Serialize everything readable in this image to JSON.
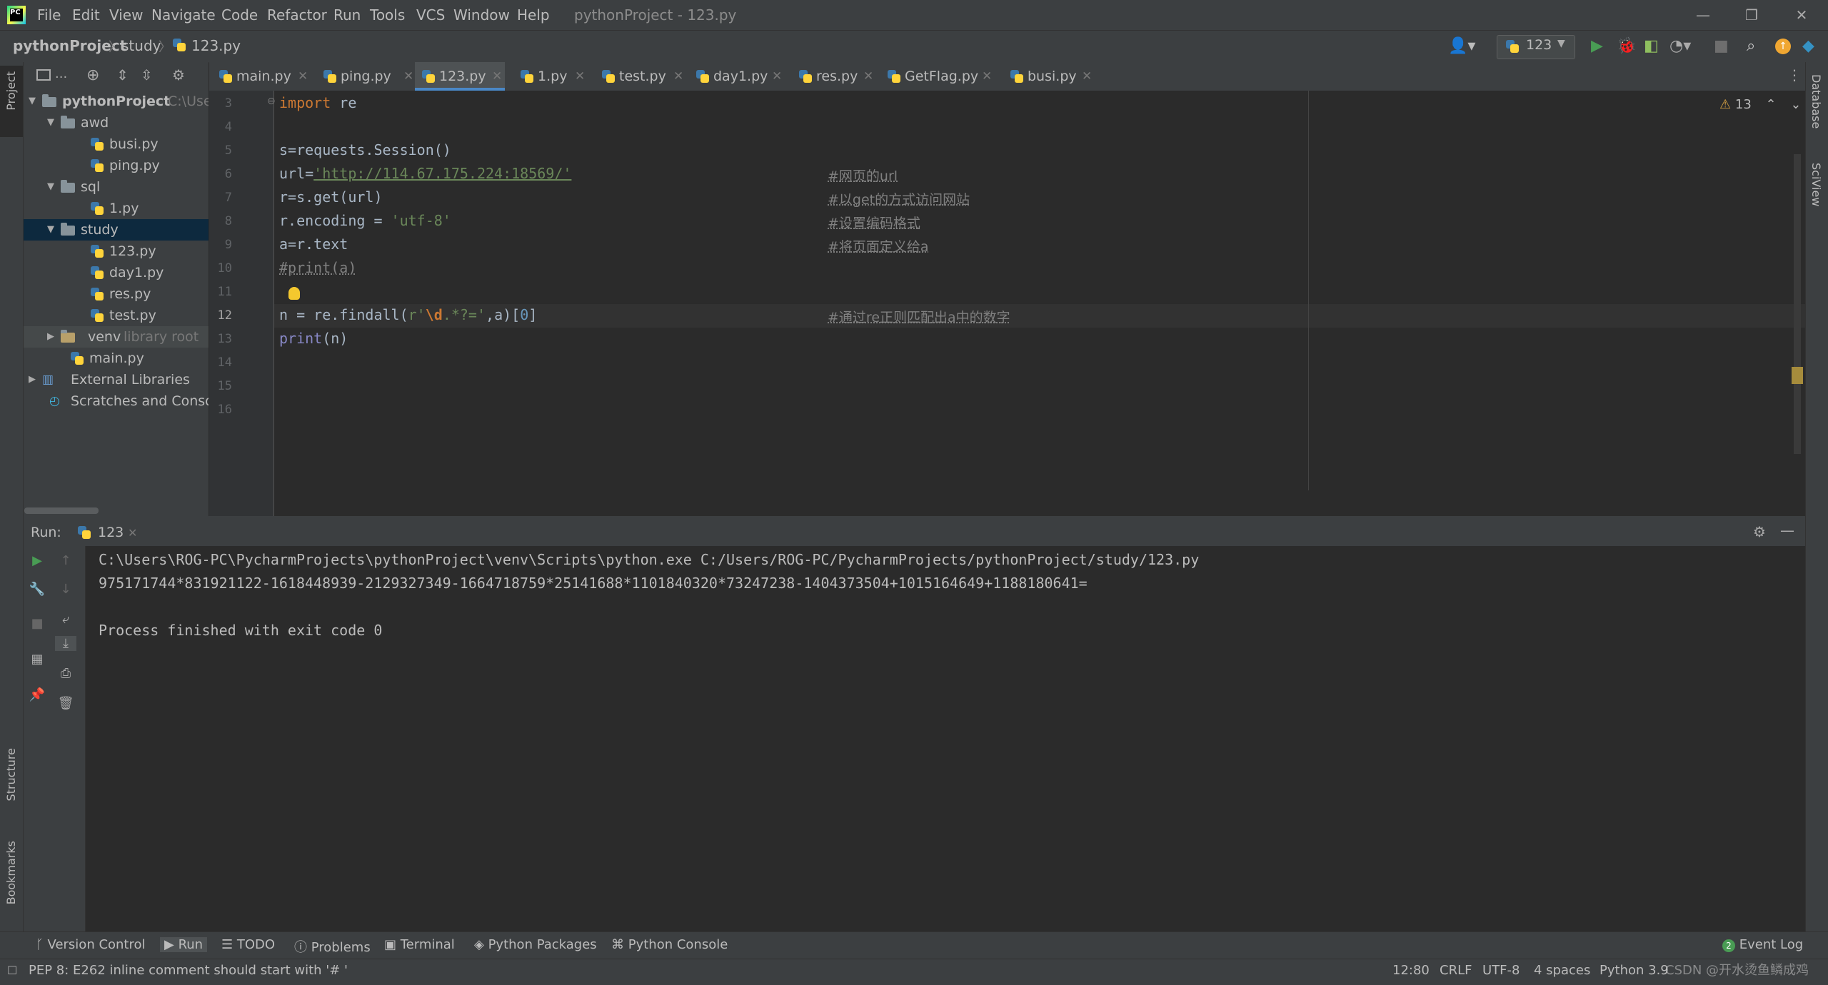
{
  "menubar": {
    "items": [
      "File",
      "Edit",
      "View",
      "Navigate",
      "Code",
      "Refactor",
      "Run",
      "Tools",
      "VCS",
      "Window",
      "Help"
    ],
    "title": "pythonProject - 123.py"
  },
  "navbar": {
    "breadcrumb": [
      "pythonProject",
      "study",
      "123.py"
    ],
    "run_config": "123"
  },
  "sidebar": {
    "left_tabs": [
      "Project",
      "Structure",
      "Bookmarks"
    ],
    "right_tabs": [
      "Database",
      "SciView"
    ]
  },
  "project": {
    "toolbar_label": "...",
    "tree": [
      {
        "label": "pythonProject",
        "extra": "C:\\Use",
        "type": "root"
      },
      {
        "label": "awd",
        "type": "folder"
      },
      {
        "label": "busi.py",
        "type": "file"
      },
      {
        "label": "ping.py",
        "type": "file"
      },
      {
        "label": "sql",
        "type": "folder"
      },
      {
        "label": "1.py",
        "type": "file"
      },
      {
        "label": "study",
        "type": "folder",
        "selected": true
      },
      {
        "label": "123.py",
        "type": "file"
      },
      {
        "label": "day1.py",
        "type": "file"
      },
      {
        "label": "res.py",
        "type": "file"
      },
      {
        "label": "test.py",
        "type": "file"
      },
      {
        "label": "venv",
        "extra": "library root",
        "type": "folder"
      },
      {
        "label": "main.py",
        "type": "file"
      },
      {
        "label": "External Libraries",
        "type": "libs"
      },
      {
        "label": "Scratches and Consoles",
        "type": "scratch"
      }
    ]
  },
  "tabs": [
    "main.py",
    "ping.py",
    "123.py",
    "1.py",
    "test.py",
    "day1.py",
    "res.py",
    "GetFlag.py",
    "busi.py"
  ],
  "active_tab": "123.py",
  "editor": {
    "line_numbers": [
      "3",
      "4",
      "5",
      "6",
      "7",
      "8",
      "9",
      "10",
      "11",
      "12",
      "13",
      "14",
      "15",
      "16"
    ],
    "code": {
      "l3": {
        "kw": "import",
        "rest": " re"
      },
      "l5": "s=requests.Session()",
      "l6": {
        "pre": "url=",
        "url": "'http://114.67.175.224:18569/'"
      },
      "l7": "r=s.get(url)",
      "l8": {
        "pre": "r.encoding = ",
        "str": "'utf-8'"
      },
      "l9": "a=r.text",
      "l10": "#print(a)",
      "l12": {
        "pre": "n = re.findall(",
        "s1": "r'",
        "esc": "\\d",
        "s2": ".*?='",
        "post": ",a)[",
        "num": "0",
        "end": "]"
      },
      "l13": {
        "fn": "print",
        "rest": "(n)"
      }
    },
    "comments": {
      "l6": "#网页的url",
      "l7": "#以get的方式访问网站",
      "l8": "#设置编码格式",
      "l9": "#将页面定义给a",
      "l12": "#通过re正则匹配出a中的数字"
    },
    "inspection_count": "13"
  },
  "run": {
    "label": "Run:",
    "tab": "123",
    "lines": [
      "C:\\Users\\ROG-PC\\PycharmProjects\\pythonProject\\venv\\Scripts\\python.exe C:/Users/ROG-PC/PycharmProjects/pythonProject/study/123.py",
      "975171744*831921122-1618448939-2129327349-1664718759*25141688*1101840320*73247238-1404373504+1015164649+1188180641=",
      "",
      "Process finished with exit code 0"
    ]
  },
  "toolwindows": [
    "Version Control",
    "Run",
    "TODO",
    "Problems",
    "Terminal",
    "Python Packages",
    "Python Console"
  ],
  "event_log": "Event Log",
  "status": {
    "message": "PEP 8: E262 inline comment should start with '# '",
    "position": "12:80",
    "line_sep": "CRLF",
    "encoding": "UTF-8",
    "indent": "4 spaces",
    "interpreter": "Python 3.9",
    "watermark": "CSDN @开水烫鱼鳞成鸡"
  }
}
